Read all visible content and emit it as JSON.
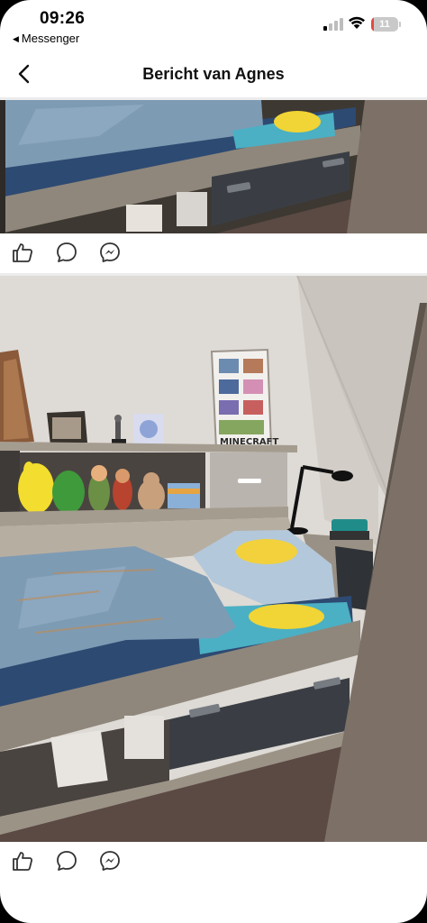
{
  "status_bar": {
    "time": "09:26",
    "back_app": "Messenger",
    "battery_level": "11",
    "battery_fraction": 0.11
  },
  "nav": {
    "title": "Bericht van Agnes",
    "back_icon": "chevron-left-icon"
  },
  "posts": [
    {
      "photo_alt": "bed-photo-top",
      "actions": [
        "like-icon",
        "comment-icon",
        "messenger-icon"
      ]
    },
    {
      "photo_alt": "bed-photo-room",
      "poster_text": "MINECRAFT",
      "actions": [
        "like-icon",
        "comment-icon",
        "messenger-icon"
      ]
    }
  ],
  "colors": {
    "accent_red": "#e5483f",
    "blanket": "#7e9bb4",
    "wood": "#8f877c",
    "drawer": "#3a3e44",
    "wall": "#dedad5",
    "carpet": "#5b4a43"
  }
}
